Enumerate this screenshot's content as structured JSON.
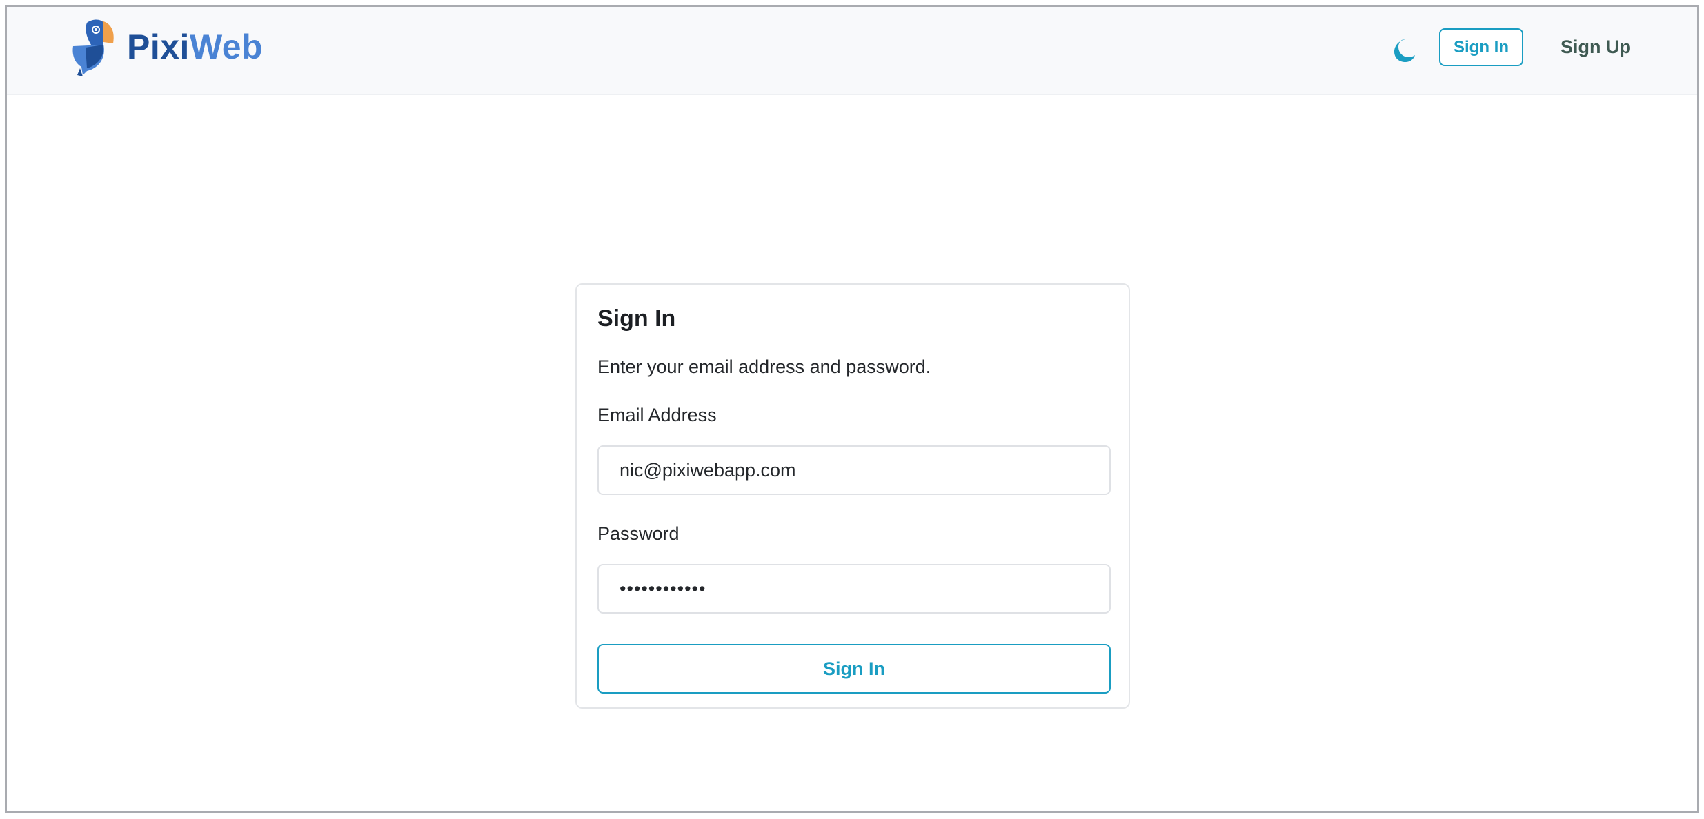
{
  "brand": {
    "name_part1": "Pixi",
    "name_part2": "Web",
    "logo_icon": "parrot-logo-icon",
    "colors": {
      "primary_dark": "#1f4f97",
      "primary_light": "#4a83d4",
      "accent_orange": "#f0a04b"
    }
  },
  "header": {
    "theme_toggle_icon": "moon-icon",
    "signin_label": "Sign In",
    "signup_label": "Sign Up"
  },
  "signin_card": {
    "title": "Sign In",
    "description": "Enter your email address and password.",
    "email_label": "Email Address",
    "email_value": "nic@pixiwebapp.com",
    "password_label": "Password",
    "password_value": "••••••••••••",
    "submit_label": "Sign In"
  },
  "colors": {
    "accent": "#1a9dc2",
    "nav_text": "#3f5a52",
    "header_bg": "#f8f9fb"
  }
}
